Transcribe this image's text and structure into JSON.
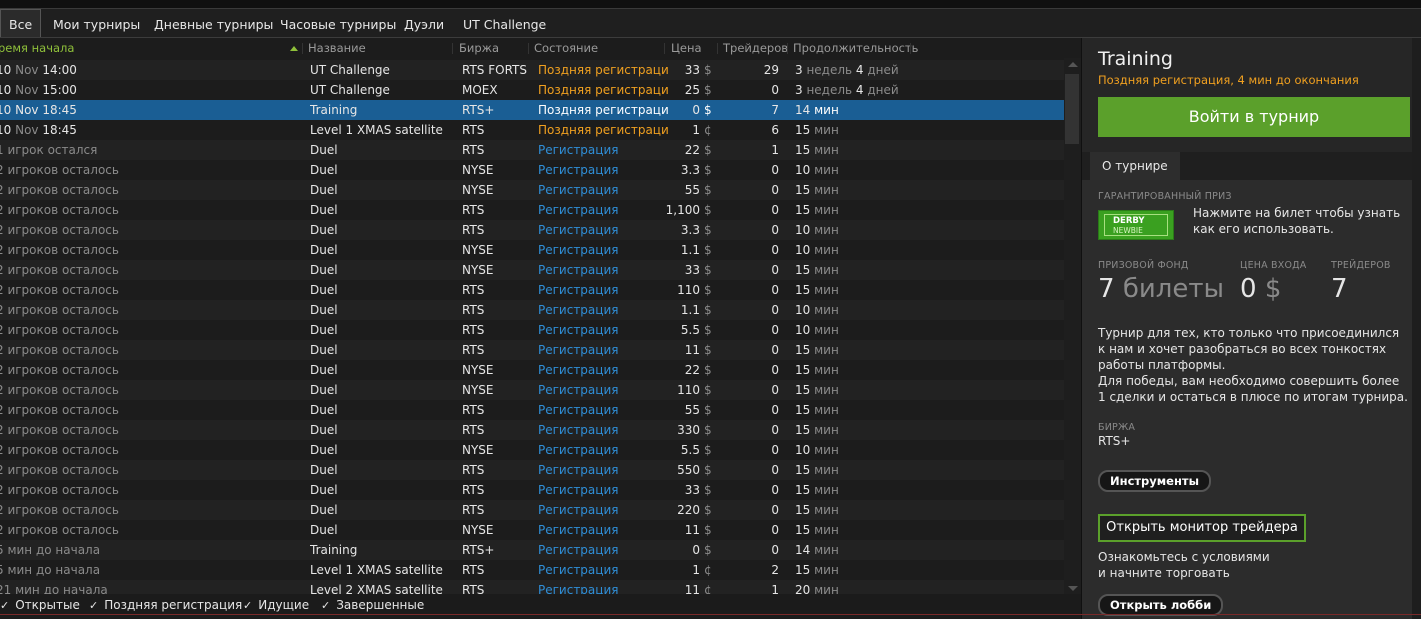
{
  "tabs": [
    {
      "label": "Все",
      "active": true
    },
    {
      "label": "Мои турниры"
    },
    {
      "label": "Дневные турниры"
    },
    {
      "label": "Часовые турниры"
    },
    {
      "label": "Дуэли"
    },
    {
      "label": "UT Challenge"
    }
  ],
  "columns": {
    "time": "ремя начала",
    "name": "Название",
    "exchange": "Биржа",
    "state": "Состояние",
    "price": "Цена",
    "traders": "Трейдеров",
    "duration": "Продолжительность"
  },
  "rows": [
    {
      "time_a": "10 ",
      "time_mo": "Nov ",
      "time_b": "14:00",
      "name": "UT Challenge",
      "exchange": "RTS FORTS",
      "state": "Поздняя регистрация",
      "state_kind": "late",
      "price": "33",
      "cur": "$",
      "traders": "29",
      "dur_n1": "3 ",
      "dur_u1": "недель ",
      "dur_n2": "4 ",
      "dur_u2": "дней"
    },
    {
      "time_a": "10 ",
      "time_mo": "Nov ",
      "time_b": "15:00",
      "name": "UT Challenge",
      "exchange": "MOEX",
      "state": "Поздняя регистрация",
      "state_kind": "late",
      "price": "25",
      "cur": "$",
      "traders": "0",
      "dur_n1": "3 ",
      "dur_u1": "недель ",
      "dur_n2": "4 ",
      "dur_u2": "дней"
    },
    {
      "time_a": "10 ",
      "time_mo": "Nov ",
      "time_b": "18:45",
      "name": "Training",
      "exchange": "RTS+",
      "state": "Поздняя регистрация",
      "state_kind": "late",
      "price": "0",
      "cur": "$",
      "traders": "7",
      "dur_n1": "14 ",
      "dur_u1": "мин",
      "selected": true
    },
    {
      "time_a": "10 ",
      "time_mo": "Nov ",
      "time_b": "18:45",
      "name": "Level 1 XMAS satellite",
      "exchange": "RTS",
      "state": "Поздняя регистрация",
      "state_kind": "late",
      "price": "1",
      "cur": "¢",
      "traders": "6",
      "dur_n1": "15 ",
      "dur_u1": "мин"
    },
    {
      "time_text": "1 игрок остался",
      "name": "Duel",
      "exchange": "RTS",
      "state": "Регистрация",
      "state_kind": "reg",
      "price": "22",
      "cur": "$",
      "traders": "1",
      "dur_n1": "15 ",
      "dur_u1": "мин"
    },
    {
      "time_text": "2 игроков осталось",
      "name": "Duel",
      "exchange": "NYSE",
      "state": "Регистрация",
      "state_kind": "reg",
      "price": "3.3",
      "cur": "$",
      "traders": "0",
      "dur_n1": "10 ",
      "dur_u1": "мин"
    },
    {
      "time_text": "2 игроков осталось",
      "name": "Duel",
      "exchange": "NYSE",
      "state": "Регистрация",
      "state_kind": "reg",
      "price": "55",
      "cur": "$",
      "traders": "0",
      "dur_n1": "15 ",
      "dur_u1": "мин"
    },
    {
      "time_text": "2 игроков осталось",
      "name": "Duel",
      "exchange": "RTS",
      "state": "Регистрация",
      "state_kind": "reg",
      "price": "1,100",
      "cur": "$",
      "traders": "0",
      "dur_n1": "15 ",
      "dur_u1": "мин"
    },
    {
      "time_text": "2 игроков осталось",
      "name": "Duel",
      "exchange": "RTS",
      "state": "Регистрация",
      "state_kind": "reg",
      "price": "3.3",
      "cur": "$",
      "traders": "0",
      "dur_n1": "10 ",
      "dur_u1": "мин"
    },
    {
      "time_text": "2 игроков осталось",
      "name": "Duel",
      "exchange": "NYSE",
      "state": "Регистрация",
      "state_kind": "reg",
      "price": "1.1",
      "cur": "$",
      "traders": "0",
      "dur_n1": "10 ",
      "dur_u1": "мин"
    },
    {
      "time_text": "2 игроков осталось",
      "name": "Duel",
      "exchange": "NYSE",
      "state": "Регистрация",
      "state_kind": "reg",
      "price": "33",
      "cur": "$",
      "traders": "0",
      "dur_n1": "15 ",
      "dur_u1": "мин"
    },
    {
      "time_text": "2 игроков осталось",
      "name": "Duel",
      "exchange": "RTS",
      "state": "Регистрация",
      "state_kind": "reg",
      "price": "110",
      "cur": "$",
      "traders": "0",
      "dur_n1": "15 ",
      "dur_u1": "мин"
    },
    {
      "time_text": "2 игроков осталось",
      "name": "Duel",
      "exchange": "RTS",
      "state": "Регистрация",
      "state_kind": "reg",
      "price": "1.1",
      "cur": "$",
      "traders": "0",
      "dur_n1": "10 ",
      "dur_u1": "мин"
    },
    {
      "time_text": "2 игроков осталось",
      "name": "Duel",
      "exchange": "RTS",
      "state": "Регистрация",
      "state_kind": "reg",
      "price": "5.5",
      "cur": "$",
      "traders": "0",
      "dur_n1": "10 ",
      "dur_u1": "мин"
    },
    {
      "time_text": "2 игроков осталось",
      "name": "Duel",
      "exchange": "RTS",
      "state": "Регистрация",
      "state_kind": "reg",
      "price": "11",
      "cur": "$",
      "traders": "0",
      "dur_n1": "15 ",
      "dur_u1": "мин"
    },
    {
      "time_text": "2 игроков осталось",
      "name": "Duel",
      "exchange": "NYSE",
      "state": "Регистрация",
      "state_kind": "reg",
      "price": "22",
      "cur": "$",
      "traders": "0",
      "dur_n1": "15 ",
      "dur_u1": "мин"
    },
    {
      "time_text": "2 игроков осталось",
      "name": "Duel",
      "exchange": "NYSE",
      "state": "Регистрация",
      "state_kind": "reg",
      "price": "110",
      "cur": "$",
      "traders": "0",
      "dur_n1": "15 ",
      "dur_u1": "мин"
    },
    {
      "time_text": "2 игроков осталось",
      "name": "Duel",
      "exchange": "RTS",
      "state": "Регистрация",
      "state_kind": "reg",
      "price": "55",
      "cur": "$",
      "traders": "0",
      "dur_n1": "15 ",
      "dur_u1": "мин"
    },
    {
      "time_text": "2 игроков осталось",
      "name": "Duel",
      "exchange": "RTS",
      "state": "Регистрация",
      "state_kind": "reg",
      "price": "330",
      "cur": "$",
      "traders": "0",
      "dur_n1": "15 ",
      "dur_u1": "мин"
    },
    {
      "time_text": "2 игроков осталось",
      "name": "Duel",
      "exchange": "NYSE",
      "state": "Регистрация",
      "state_kind": "reg",
      "price": "5.5",
      "cur": "$",
      "traders": "0",
      "dur_n1": "10 ",
      "dur_u1": "мин"
    },
    {
      "time_text": "2 игроков осталось",
      "name": "Duel",
      "exchange": "RTS",
      "state": "Регистрация",
      "state_kind": "reg",
      "price": "550",
      "cur": "$",
      "traders": "0",
      "dur_n1": "15 ",
      "dur_u1": "мин"
    },
    {
      "time_text": "2 игроков осталось",
      "name": "Duel",
      "exchange": "RTS",
      "state": "Регистрация",
      "state_kind": "reg",
      "price": "33",
      "cur": "$",
      "traders": "0",
      "dur_n1": "15 ",
      "dur_u1": "мин"
    },
    {
      "time_text": "2 игроков осталось",
      "name": "Duel",
      "exchange": "RTS",
      "state": "Регистрация",
      "state_kind": "reg",
      "price": "220",
      "cur": "$",
      "traders": "0",
      "dur_n1": "15 ",
      "dur_u1": "мин"
    },
    {
      "time_text": "2 игроков осталось",
      "name": "Duel",
      "exchange": "NYSE",
      "state": "Регистрация",
      "state_kind": "reg",
      "price": "11",
      "cur": "$",
      "traders": "0",
      "dur_n1": "15 ",
      "dur_u1": "мин"
    },
    {
      "time_text": "5 мин до начала",
      "name": "Training",
      "exchange": "RTS+",
      "state": "Регистрация",
      "state_kind": "reg",
      "price": "0",
      "cur": "$",
      "traders": "0",
      "dur_n1": "14 ",
      "dur_u1": "мин"
    },
    {
      "time_text": "5 мин до начала",
      "name": "Level 1 XMAS satellite",
      "exchange": "RTS",
      "state": "Регистрация",
      "state_kind": "reg",
      "price": "1",
      "cur": "¢",
      "traders": "2",
      "dur_n1": "15 ",
      "dur_u1": "мин"
    },
    {
      "time_text": "21 мин до начала",
      "name": "Level 2 XMAS satellite",
      "exchange": "RTS",
      "state": "Регистрация",
      "state_kind": "reg",
      "price": "11",
      "cur": "¢",
      "traders": "1",
      "dur_n1": "20 ",
      "dur_u1": "мин"
    }
  ],
  "filters": [
    {
      "label": "Открытые"
    },
    {
      "label": "Поздняя регистрация"
    },
    {
      "label": "Идущие"
    },
    {
      "label": "Завершенные"
    }
  ],
  "details": {
    "title": "Training",
    "status": "Поздняя регистрация, 4 мин до окончания",
    "join_button": "Войти в турнир",
    "tab_about": "О турнире",
    "guaranteed_label": "ГАРАНТИРОВАННЫЙ ПРИЗ",
    "ticket_line1": "DERBY",
    "ticket_line2": "NEWBIE",
    "ticket_hint": "Нажмите на билет чтобы узнать как его использовать.",
    "prize_label": "ПРИЗОВОЙ ФОНД",
    "prize_value": "7",
    "prize_unit": "билеты",
    "entry_label": "ЦЕНА ВХОДА",
    "entry_value": "0",
    "entry_unit": "$",
    "traders_label": "ТРЕЙДЕРОВ",
    "traders_value": "7",
    "description": "Турнир для тех, кто только что присоединился к нам и хочет разобраться во всех тонкостях работы платформы.\nДля победы, вам необходимо совершить более 1 сделки и остаться в плюсе по итогам турнира.",
    "exchange_label": "БИРЖА",
    "exchange_value": "RTS+",
    "instruments_button": "Инструменты",
    "monitor_button": "Открыть монитор трейдера",
    "monitor_hint": "Ознакомьтесь с условиями\nи начните торговать",
    "lobby_button": "Открыть лобби"
  },
  "colors": {
    "accent_green": "#5ba02b",
    "selection_blue": "#1a5e94",
    "late_orange": "#f0a020",
    "reg_blue": "#2f8fd8"
  }
}
